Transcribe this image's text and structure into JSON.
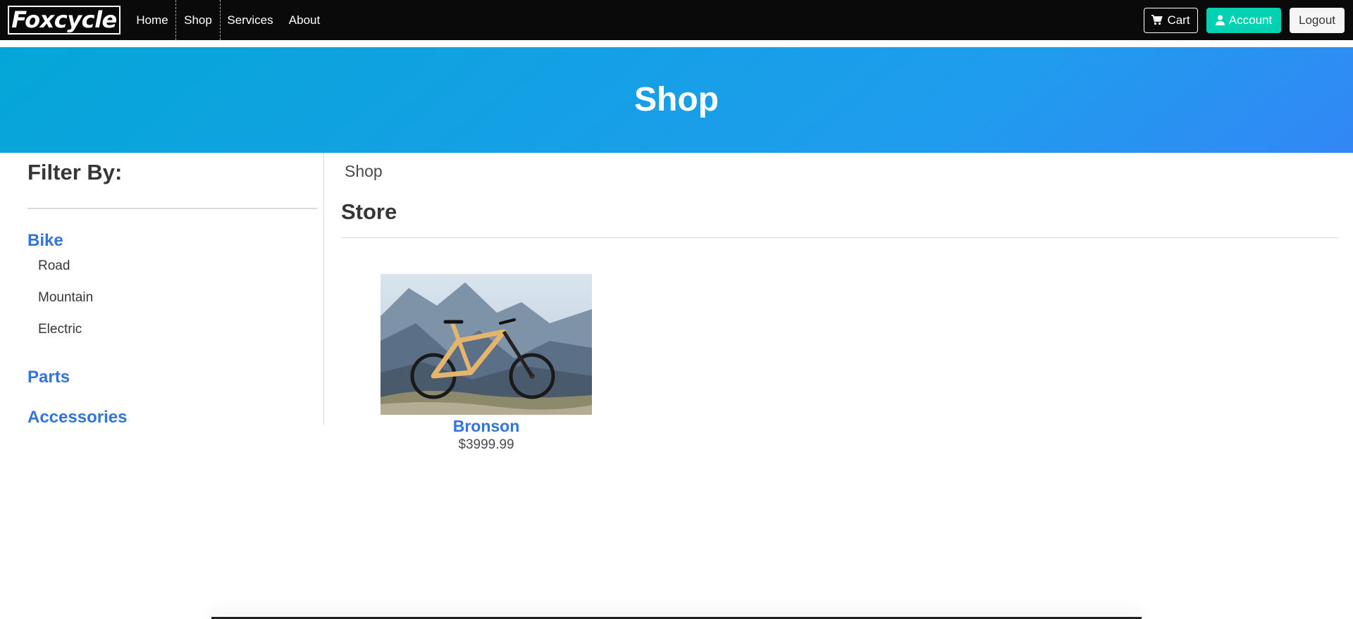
{
  "navbar": {
    "brand": "Foxcycle",
    "links": [
      "Home",
      "Shop",
      "Services",
      "About"
    ],
    "cart_label": "Cart",
    "account_label": "Account",
    "logout_label": "Logout",
    "active_link": "Shop",
    "cart_icon": "cart-icon",
    "account_icon": "user-icon"
  },
  "hero": {
    "title": "Shop"
  },
  "sidebar": {
    "title": "Filter By:",
    "categories": [
      {
        "label": "Bike",
        "children": [
          "Road",
          "Mountain",
          "Electric"
        ]
      },
      {
        "label": "Parts",
        "children": []
      },
      {
        "label": "Accessories",
        "children": []
      }
    ]
  },
  "main": {
    "breadcrumb": "Shop",
    "title": "Store",
    "products": [
      {
        "name": "Bronson",
        "price": "$3999.99"
      }
    ]
  },
  "colors": {
    "navbar_bg": "#0a0a0a",
    "accent": "#3273dc",
    "account_button": "#00d1b2",
    "hero_gradient_start": "#04a6d7",
    "hero_gradient_end": "#3287f5"
  }
}
